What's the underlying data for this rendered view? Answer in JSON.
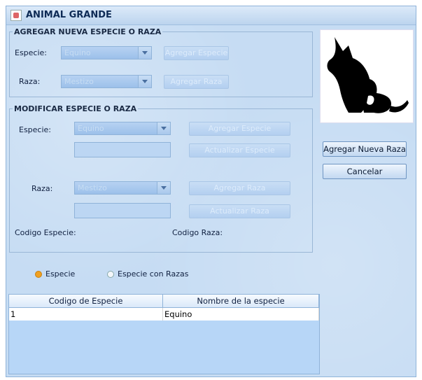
{
  "window": {
    "title": "ANIMAL GRANDE"
  },
  "agregar": {
    "legend": "AGREGAR NUEVA ESPECIE O RAZA",
    "especie_label": "Especie:",
    "especie_value": "Equino",
    "agregar_especie": "Agregar Especie",
    "raza_label": "Raza:",
    "raza_value": "Mestizo",
    "agregar_raza": "Agregar Raza"
  },
  "modificar": {
    "legend": "MODIFICAR  ESPECIE O RAZA",
    "especie_label": "Especie:",
    "especie_value": "Equino",
    "agregar_especie": "Agregar Especie",
    "actualizar_especie": "Actualizar Especie",
    "raza_label": "Raza:",
    "raza_value": "Mestizo",
    "agregar_raza": "Agregar Raza",
    "actualizar_raza": "Actualizar Raza",
    "codigo_especie": "Codigo Especie:",
    "codigo_raza": "Codigo Raza:"
  },
  "actions": {
    "agregar_nueva_raza": "Agregar Nueva Raza",
    "cancelar": "Cancelar"
  },
  "filter": {
    "radio_especie": "Especie",
    "radio_especie_razas": "Especie con Razas",
    "selected": "Especie"
  },
  "table": {
    "columns": [
      "Codigo de Especie",
      "Nombre de la especie"
    ],
    "rows": [
      [
        "1",
        "Equino"
      ]
    ]
  },
  "colors": {
    "radio_selected": "#f0a020",
    "window_bg": "#c6dcf3"
  },
  "icons": {
    "logo": "dog-cat-silhouette-logo"
  }
}
